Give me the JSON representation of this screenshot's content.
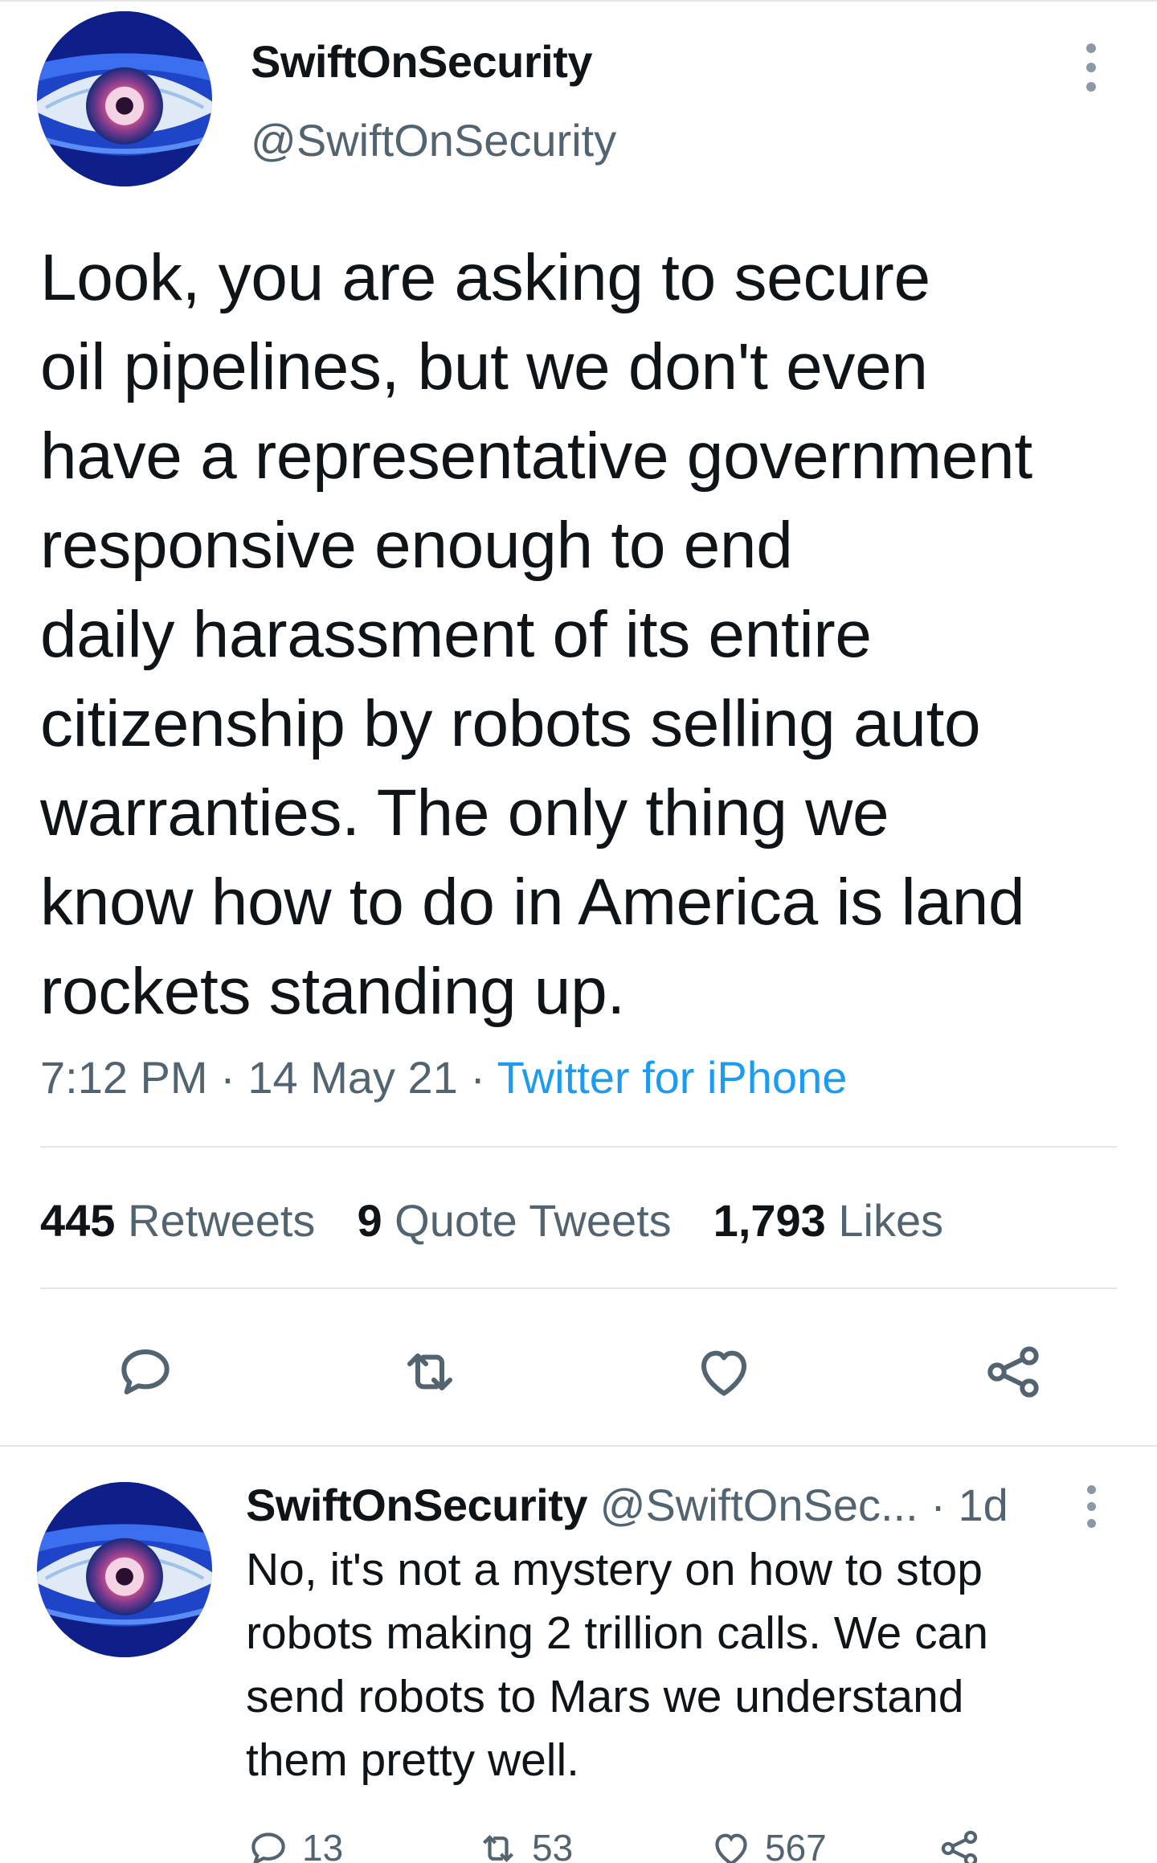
{
  "tweet": {
    "display_name": "SwiftOnSecurity",
    "handle": "@SwiftOnSecurity",
    "text": "Look, you are asking to secure\noil pipelines, but we don't even\nhave a representative government\nresponsive enough to end\ndaily harassment of its entire\ncitizenship by robots selling auto\nwarranties. The only thing we\nknow how to do in America is land\nrockets standing up.",
    "time": "7:12 PM",
    "date": "14 May 21",
    "source": "Twitter for iPhone",
    "stats": {
      "retweets_count": "445",
      "retweets_label": "Retweets",
      "quotes_count": "9",
      "quotes_label": "Quote Tweets",
      "likes_count": "1,793",
      "likes_label": "Likes"
    },
    "actions": [
      "reply-icon",
      "retweet-icon",
      "like-icon",
      "share-icon"
    ]
  },
  "reply": {
    "display_name": "SwiftOnSecurity",
    "handle": "@SwiftOnSec...",
    "age": "1d",
    "text": "No, it's not a mystery on how to stop\nrobots making 2 trillion calls. We can\nsend robots to Mars we understand\nthem pretty well.",
    "reply_count": "13",
    "retweet_count": "53",
    "like_count": "567"
  },
  "colors": {
    "text_primary": "#0f1419",
    "text_secondary": "#536471",
    "link": "#1d9bf0",
    "divider": "#e4e7ea"
  }
}
